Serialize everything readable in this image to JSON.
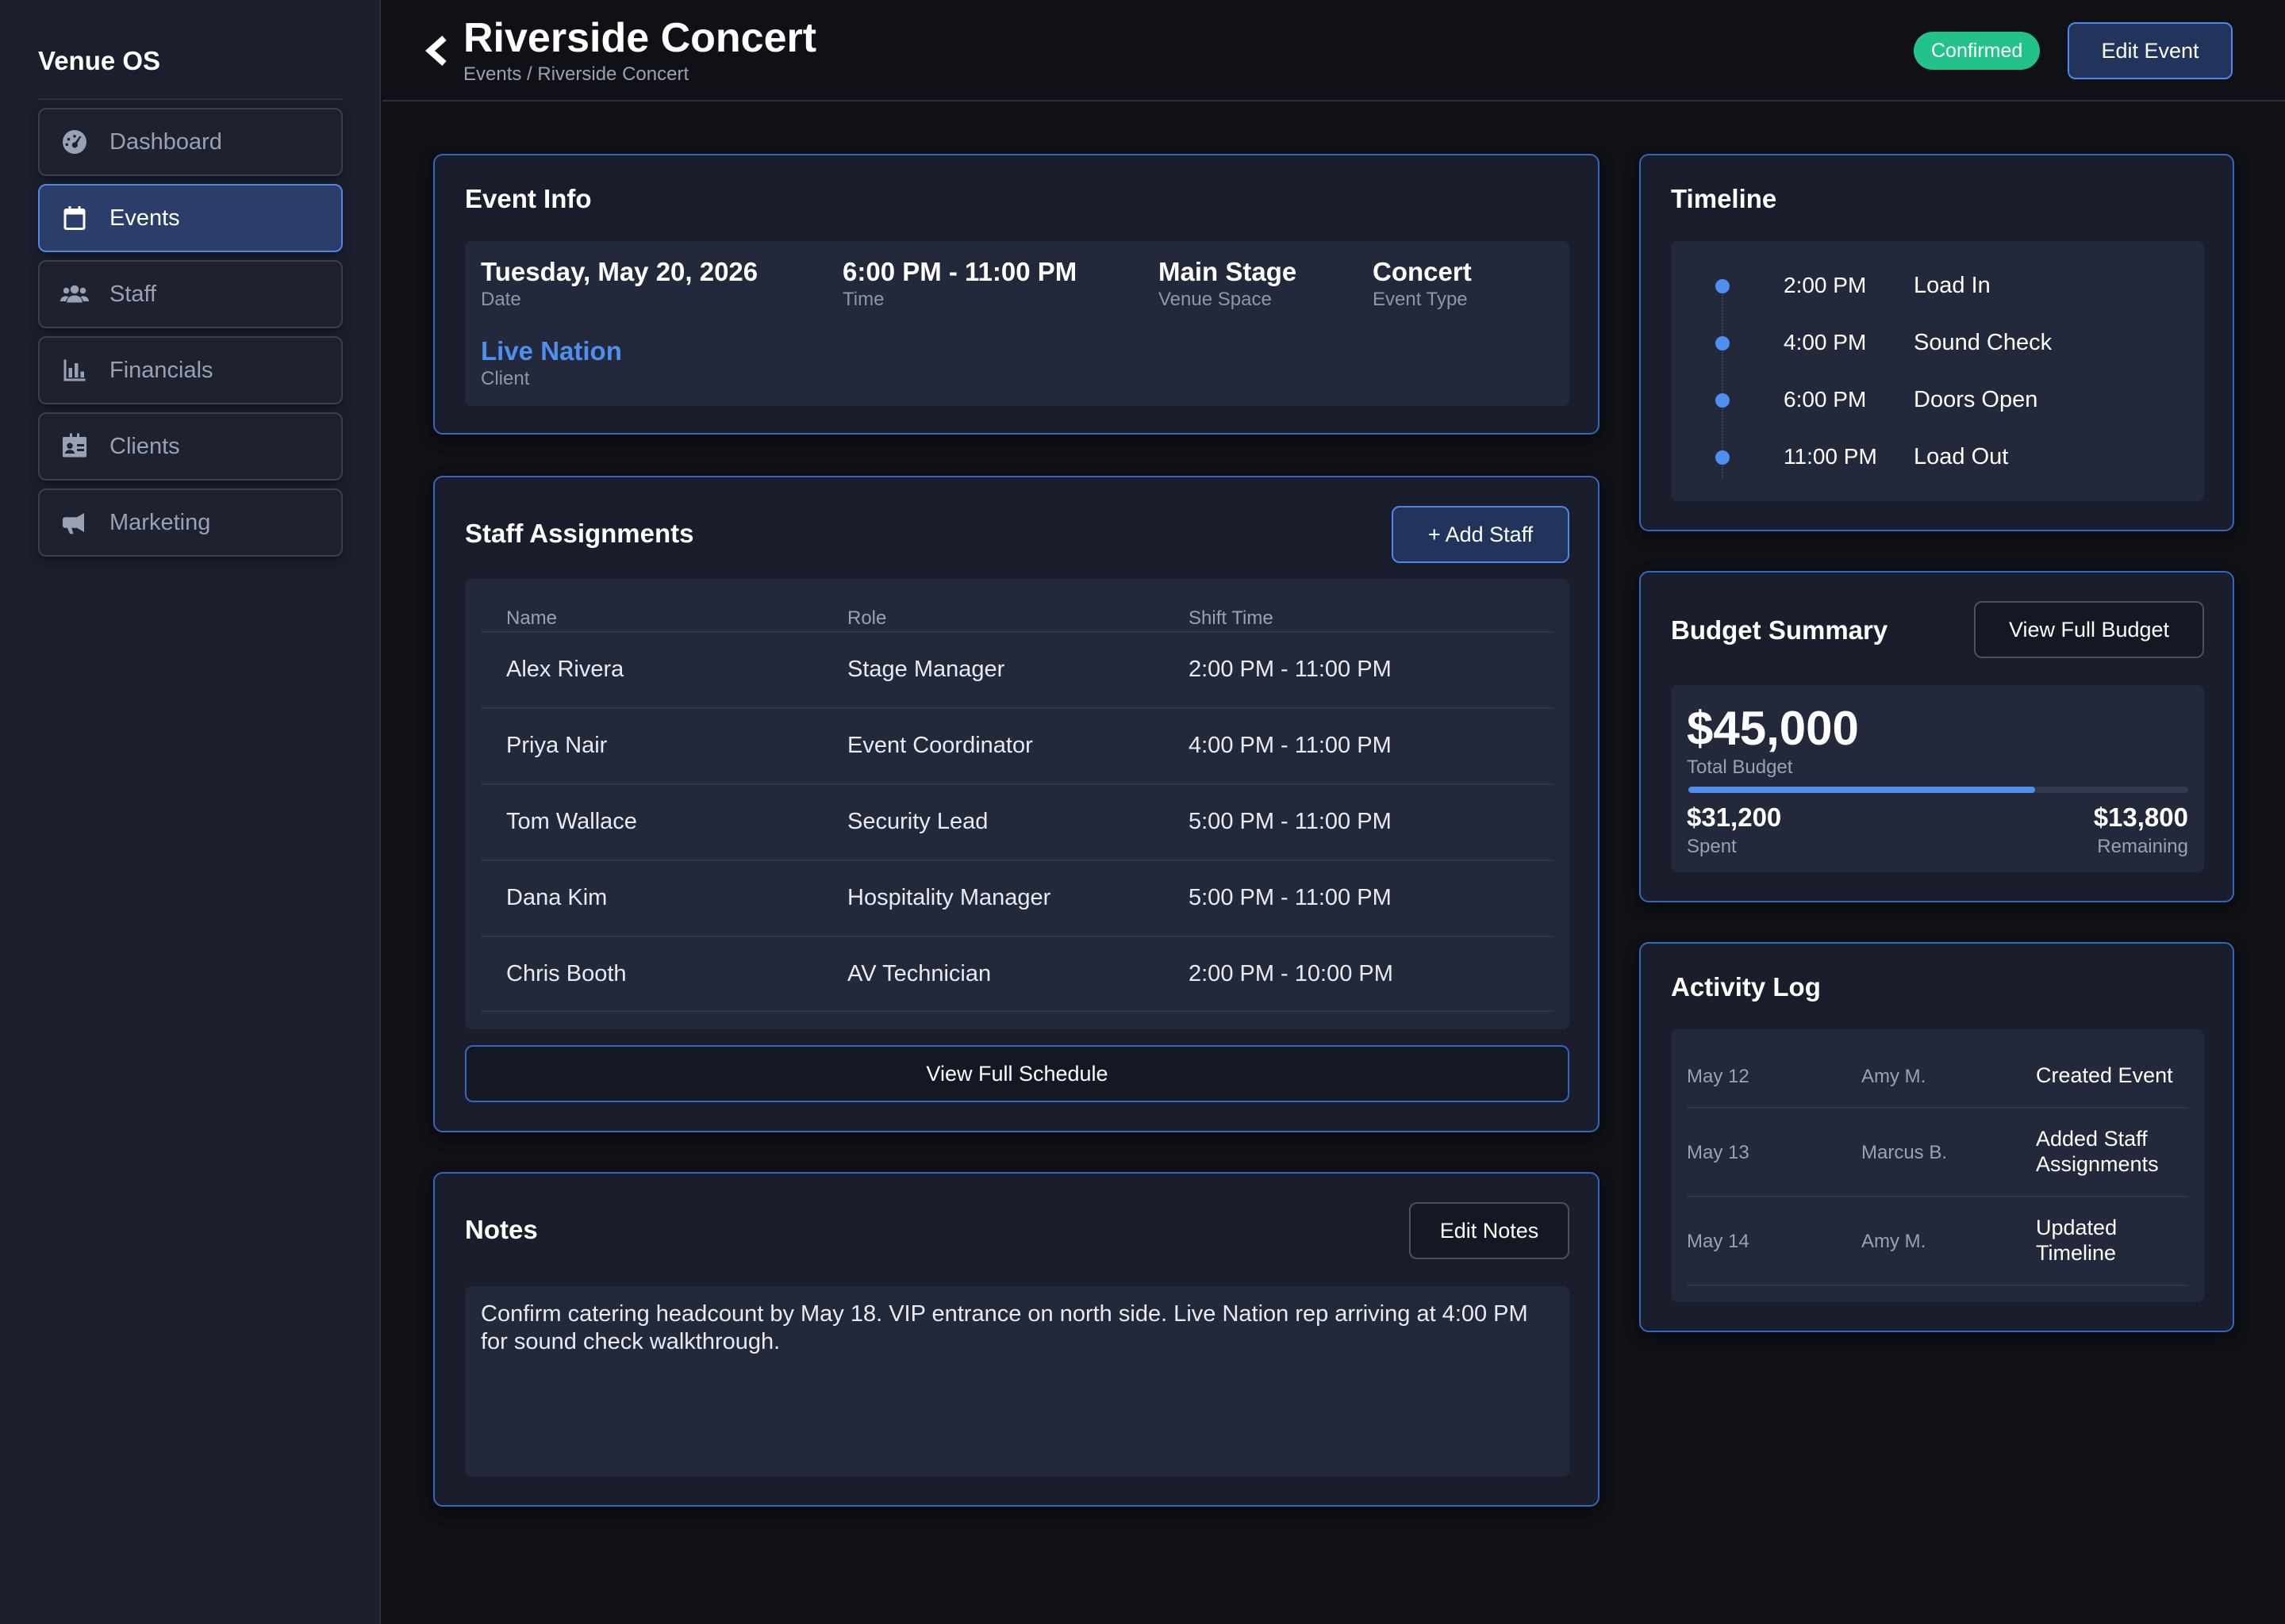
{
  "sidebar": {
    "brand": "Venue OS",
    "items": [
      {
        "label": "Dashboard",
        "icon": "gauge-icon"
      },
      {
        "label": "Events",
        "icon": "calendar-icon"
      },
      {
        "label": "Staff",
        "icon": "users-icon"
      },
      {
        "label": "Financials",
        "icon": "bar-chart-icon"
      },
      {
        "label": "Clients",
        "icon": "contact-card-icon"
      },
      {
        "label": "Marketing",
        "icon": "megaphone-icon"
      }
    ],
    "active": "Events"
  },
  "header": {
    "title": "Riverside Concert",
    "breadcrumb": "Events / Riverside Concert",
    "status": "Confirmed",
    "edit_label": "Edit Event"
  },
  "event_info": {
    "title": "Event Info",
    "date": {
      "value": "Tuesday, May 20, 2026",
      "label": "Date"
    },
    "time": {
      "value": "6:00 PM - 11:00 PM",
      "label": "Time"
    },
    "space": {
      "value": "Main Stage",
      "label": "Venue Space"
    },
    "type": {
      "value": "Concert",
      "label": "Event Type"
    },
    "client": {
      "value": "Live Nation",
      "label": "Client"
    }
  },
  "staff": {
    "title": "Staff Assignments",
    "add_label": "+ Add Staff",
    "columns": [
      "Name",
      "Role",
      "Shift Time"
    ],
    "rows": [
      {
        "name": "Alex Rivera",
        "role": "Stage Manager",
        "shift": "2:00 PM - 11:00 PM"
      },
      {
        "name": "Priya Nair",
        "role": "Event Coordinator",
        "shift": "4:00 PM - 11:00 PM"
      },
      {
        "name": "Tom Wallace",
        "role": "Security Lead",
        "shift": "5:00 PM - 11:00 PM"
      },
      {
        "name": "Dana Kim",
        "role": "Hospitality Manager",
        "shift": "5:00 PM - 11:00 PM"
      },
      {
        "name": "Chris Booth",
        "role": "AV Technician",
        "shift": "2:00 PM - 10:00 PM"
      }
    ],
    "schedule_label": "View Full Schedule"
  },
  "notes": {
    "title": "Notes",
    "edit_label": "Edit Notes",
    "text": "Confirm catering headcount by May 18. VIP entrance on north side. Live Nation rep arriving at 4:00 PM for sound check walkthrough."
  },
  "timeline": {
    "title": "Timeline",
    "items": [
      {
        "time": "2:00 PM",
        "label": "Load In"
      },
      {
        "time": "4:00 PM",
        "label": "Sound Check"
      },
      {
        "time": "6:00 PM",
        "label": "Doors Open"
      },
      {
        "time": "11:00 PM",
        "label": "Load Out"
      }
    ]
  },
  "budget": {
    "title": "Budget Summary",
    "view_label": "View Full Budget",
    "total": "$45,000",
    "total_label": "Total Budget",
    "spent": "$31,200",
    "spent_label": "Spent",
    "remaining": "$13,800",
    "remaining_label": "Remaining",
    "spent_fraction": 0.6933
  },
  "activity": {
    "title": "Activity Log",
    "rows": [
      {
        "date": "May 12",
        "user": "Amy M.",
        "text": "Created Event"
      },
      {
        "date": "May 13",
        "user": "Marcus B.",
        "text": "Added Staff Assignments"
      },
      {
        "date": "May 14",
        "user": "Amy M.",
        "text": "Updated Timeline"
      }
    ]
  },
  "colors": {
    "accent": "#4f8ff0",
    "status_green": "#22c28a",
    "card_border": "#3565bd"
  }
}
